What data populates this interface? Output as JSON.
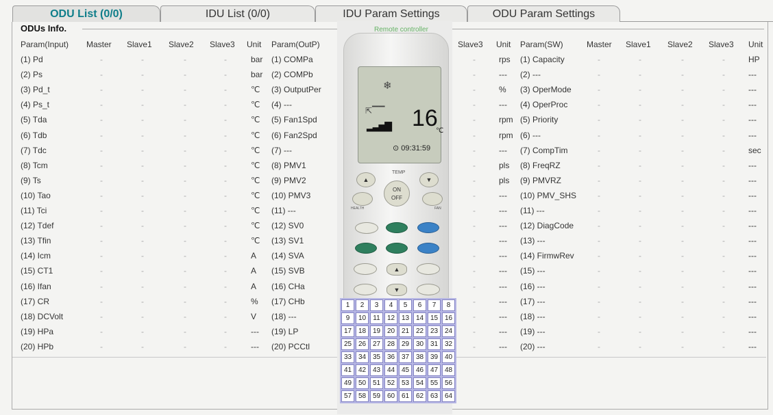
{
  "tabs": [
    "ODU List (0/0)",
    "IDU List (0/0)",
    "IDU Param Settings",
    "ODU Param Settings"
  ],
  "section_title": "ODUs  Info.",
  "dash": "-",
  "left_headers": [
    "Param(Input)",
    "Master",
    "Slave1",
    "Slave2",
    "Slave3",
    "Unit",
    "Param(OutP)"
  ],
  "right_headers": [
    "Slave3",
    "Unit",
    "Param(SW)",
    "Master",
    "Slave1",
    "Slave2",
    "Slave3",
    "Unit"
  ],
  "input_params": [
    "(1) Pd",
    "(2) Ps",
    "(3) Pd_t",
    "(4) Ps_t",
    "(5) Tda",
    "(6) Tdb",
    "(7) Tdc",
    "(8) Tcm",
    "(9) Ts",
    "(10) Tao",
    "(11) Tci",
    "(12) Tdef",
    "(13) Tfin",
    "(14) Icm",
    "(15) CT1",
    "(16) Ifan",
    "(17) CR",
    "(18) DCVolt",
    "(19) HPa",
    "(20) HPb"
  ],
  "input_units": [
    "bar",
    "bar",
    "℃",
    "℃",
    "℃",
    "℃",
    "℃",
    "℃",
    "℃",
    "℃",
    "℃",
    "℃",
    "℃",
    "A",
    "A",
    "A",
    "%",
    "V",
    "---",
    "---"
  ],
  "output_params": [
    "(1) COMPa",
    "(2) COMPb",
    "(3) OutputPer",
    "(4) ---",
    "(5) Fan1Spd",
    "(6) Fan2Spd",
    "(7) ---",
    "(8) PMV1",
    "(9) PMV2",
    "(10) PMV3",
    "(11) ---",
    "(12) SV0",
    "(13) SV1",
    "(14) SVA",
    "(15) SVB",
    "(16) CHa",
    "(17) CHb",
    "(18) ---",
    "(19) LP",
    "(20) PCCtl"
  ],
  "output_units": [
    "rps",
    "---",
    "%",
    "---",
    "rpm",
    "rpm",
    "---",
    "pls",
    "pls",
    "---",
    "---",
    "---",
    "---",
    "---",
    "---",
    "---",
    "---",
    "---",
    "---",
    "---"
  ],
  "sw_params": [
    "(1) Capacity",
    "(2) ---",
    "(3) OperMode",
    "(4) OperProc",
    "(5) Priority",
    "(6) ---",
    "(7) CompTim",
    "(8) FreqRZ",
    "(9) PMVRZ",
    "(10) PMV_SHS",
    "(11) ---",
    "(12) DiagCode",
    "(13) ---",
    "(14) FirmwRev",
    "(15) ---",
    "(16) ---",
    "(17) ---",
    "(18) ---",
    "(19) ---",
    "(20) ---"
  ],
  "sw_units": [
    "HP",
    "---",
    "---",
    "---",
    "---",
    "---",
    "sec",
    "---",
    "---",
    "---",
    "---",
    "---",
    "---",
    "---",
    "---",
    "---",
    "---",
    "---",
    "---",
    "---"
  ],
  "remote": {
    "label": "Remote controller",
    "temperature": "16",
    "temp_unit": "℃",
    "time": "09:31:59",
    "temp_label": "TEMP",
    "power_on": "ON",
    "power_off": "OFF",
    "health_label": "HEALTH",
    "fan_label": "FAN",
    "keys": [
      "1",
      "2",
      "3",
      "4",
      "5",
      "6",
      "7",
      "8",
      "9",
      "10",
      "11",
      "12",
      "13",
      "14",
      "15",
      "16",
      "17",
      "18",
      "19",
      "20",
      "21",
      "22",
      "23",
      "24",
      "25",
      "26",
      "27",
      "28",
      "29",
      "30",
      "31",
      "32",
      "33",
      "34",
      "35",
      "36",
      "37",
      "38",
      "39",
      "40",
      "41",
      "42",
      "43",
      "44",
      "45",
      "46",
      "47",
      "48",
      "49",
      "50",
      "51",
      "52",
      "53",
      "54",
      "55",
      "56",
      "57",
      "58",
      "59",
      "60",
      "61",
      "62",
      "63",
      "64"
    ]
  },
  "colors": {
    "active_tab": "#0f7e8a",
    "remote_label": "#66b366",
    "key_grid": "#b6b6e4"
  }
}
